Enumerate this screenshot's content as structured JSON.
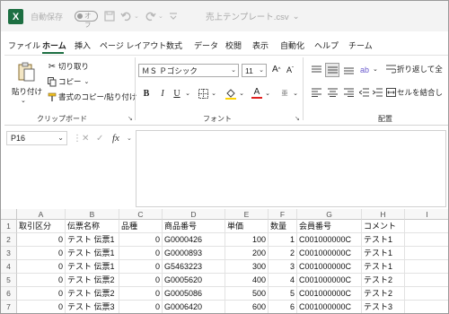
{
  "titlebar": {
    "app_icon": "excel-logo",
    "app_letter": "X",
    "autosave_label": "自動保存",
    "autosave_state": "オフ",
    "doc_title": "売上テンプレート.csv",
    "title_dropdown": "⌄"
  },
  "menu": {
    "items": [
      "ファイル",
      "ホーム",
      "挿入",
      "ページ レイアウト",
      "数式",
      "データ",
      "校閲",
      "表示",
      "自動化",
      "ヘルプ",
      "チーム"
    ],
    "active": "ホーム"
  },
  "ribbon": {
    "clipboard": {
      "paste_label": "貼り付け",
      "cut_label": "切り取り",
      "copy_label": "コピー",
      "format_painter_label": "書式のコピー/貼り付け",
      "group_label": "クリップボード"
    },
    "font": {
      "font_name": "ＭＳ Ｐゴシック",
      "font_size": "11",
      "group_label": "フォント"
    },
    "alignment": {
      "wrap_text_label": "折り返して全",
      "merge_label": "セルを結合し",
      "group_label": "配置"
    }
  },
  "formula_bar": {
    "name_box": "P16",
    "fx": "fx",
    "formula": ""
  },
  "sheet": {
    "columns": [
      "A",
      "B",
      "C",
      "D",
      "E",
      "F",
      "G",
      "H",
      "I"
    ],
    "row_numbers": [
      "1",
      "2",
      "3",
      "4",
      "5",
      "6",
      "7",
      "8"
    ],
    "rows": [
      [
        "取引区分",
        "伝票名称",
        "品種",
        "商品番号",
        "単価",
        "数量",
        "会員番号",
        "コメント",
        ""
      ],
      [
        "0",
        "テスト 伝票1",
        "0",
        "G0000426",
        "100",
        "1",
        "C001000000C",
        "テスト1",
        ""
      ],
      [
        "0",
        "テスト 伝票1",
        "0",
        "G0000893",
        "200",
        "2",
        "C001000000C",
        "テスト1",
        ""
      ],
      [
        "0",
        "テスト 伝票1",
        "0",
        "G5463223",
        "300",
        "3",
        "C001000000C",
        "テスト1",
        ""
      ],
      [
        "0",
        "テスト 伝票2",
        "0",
        "G0005620",
        "400",
        "4",
        "C001000000C",
        "テスト2",
        ""
      ],
      [
        "0",
        "テスト 伝票2",
        "0",
        "G0005086",
        "500",
        "5",
        "C001000000C",
        "テスト2",
        ""
      ],
      [
        "0",
        "テスト 伝票3",
        "0",
        "G0006420",
        "600",
        "6",
        "C001000000C",
        "テスト3",
        ""
      ],
      [
        "",
        "",
        "",
        "",
        "",
        "",
        "",
        "",
        ""
      ]
    ]
  },
  "colors": {
    "excel_green": "#1d6f42",
    "font_color_red": "#e02020",
    "highlight_yellow": "#ffd400"
  }
}
